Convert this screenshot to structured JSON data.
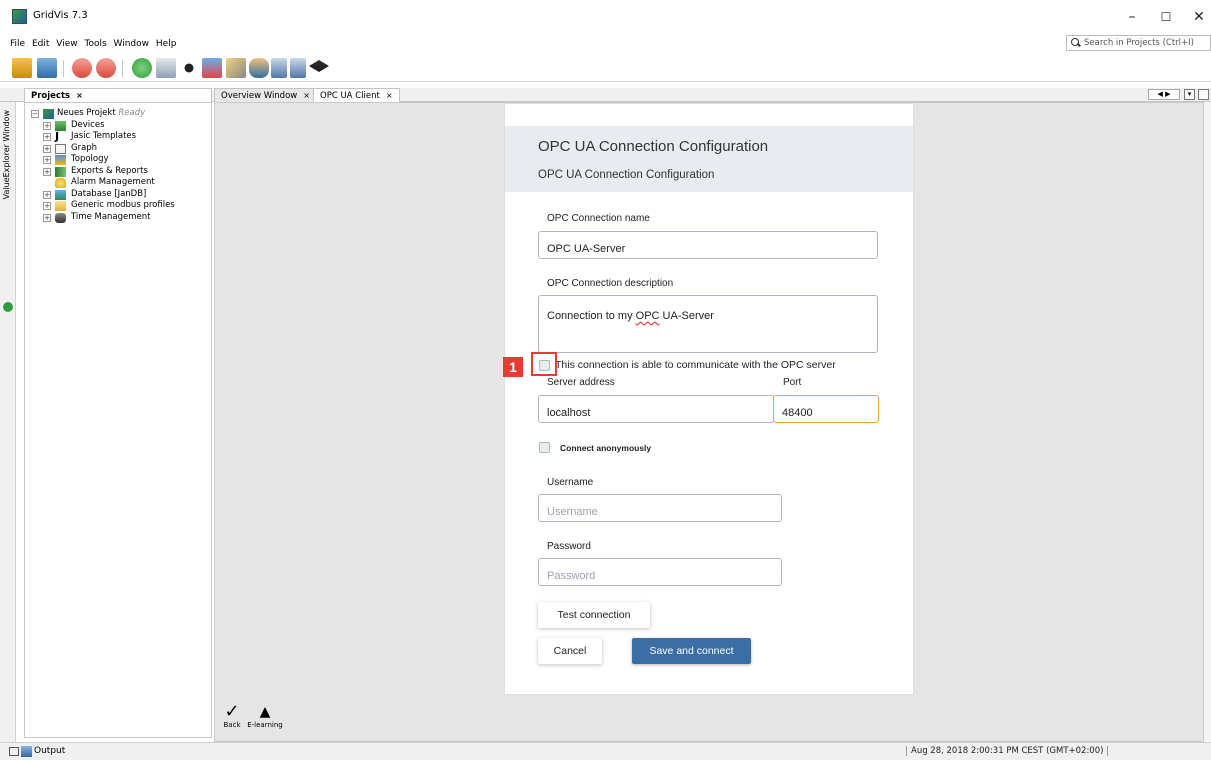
{
  "window": {
    "title": "GridVis 7.3"
  },
  "menu": {
    "items": [
      "File",
      "Edit",
      "View",
      "Tools",
      "Window",
      "Help"
    ]
  },
  "search": {
    "placeholder": "Search in Projects (Ctrl+I)"
  },
  "tabs": {
    "projects": "Projects",
    "overview": "Overview Window",
    "opcua": "OPC UA Client"
  },
  "side_panel": {
    "label": "ValueExplorer Window"
  },
  "tree": {
    "root": "Neues Projekt",
    "root_status": "Ready",
    "items": [
      "Devices",
      "Jasic Templates",
      "Graph",
      "Topology",
      "Exports & Reports",
      "Alarm Management",
      "Database [JanDB]",
      "Generic modbus profiles",
      "Time Management"
    ]
  },
  "dialog": {
    "title": "OPC UA Connection Configuration",
    "subtitle": "OPC UA Connection Configuration",
    "conn_name_label": "OPC Connection name",
    "conn_name_value": "OPC UA-Server",
    "conn_desc_label": "OPC Connection description",
    "conn_desc_prefix": "Connection to my ",
    "conn_desc_spell": "OPC",
    "conn_desc_suffix": " UA-Server",
    "communicate_label": "This connection is able to communicate with the OPC server",
    "server_label": "Server address",
    "server_value": "localhost",
    "port_label": "Port",
    "port_value": "48400",
    "anon_label": "Connect anonymously",
    "username_label": "Username",
    "username_placeholder": "Username",
    "password_label": "Password",
    "password_placeholder": "Password",
    "test_button": "Test connection",
    "cancel_button": "Cancel",
    "save_button": "Save and connect"
  },
  "annotation": {
    "marker": "1"
  },
  "bottom_tools": {
    "back": "Back",
    "elearning": "E-learning"
  },
  "status": {
    "output": "Output",
    "time": "Aug 28, 2018 2:00:31 PM CEST (GMT+02:00)"
  }
}
